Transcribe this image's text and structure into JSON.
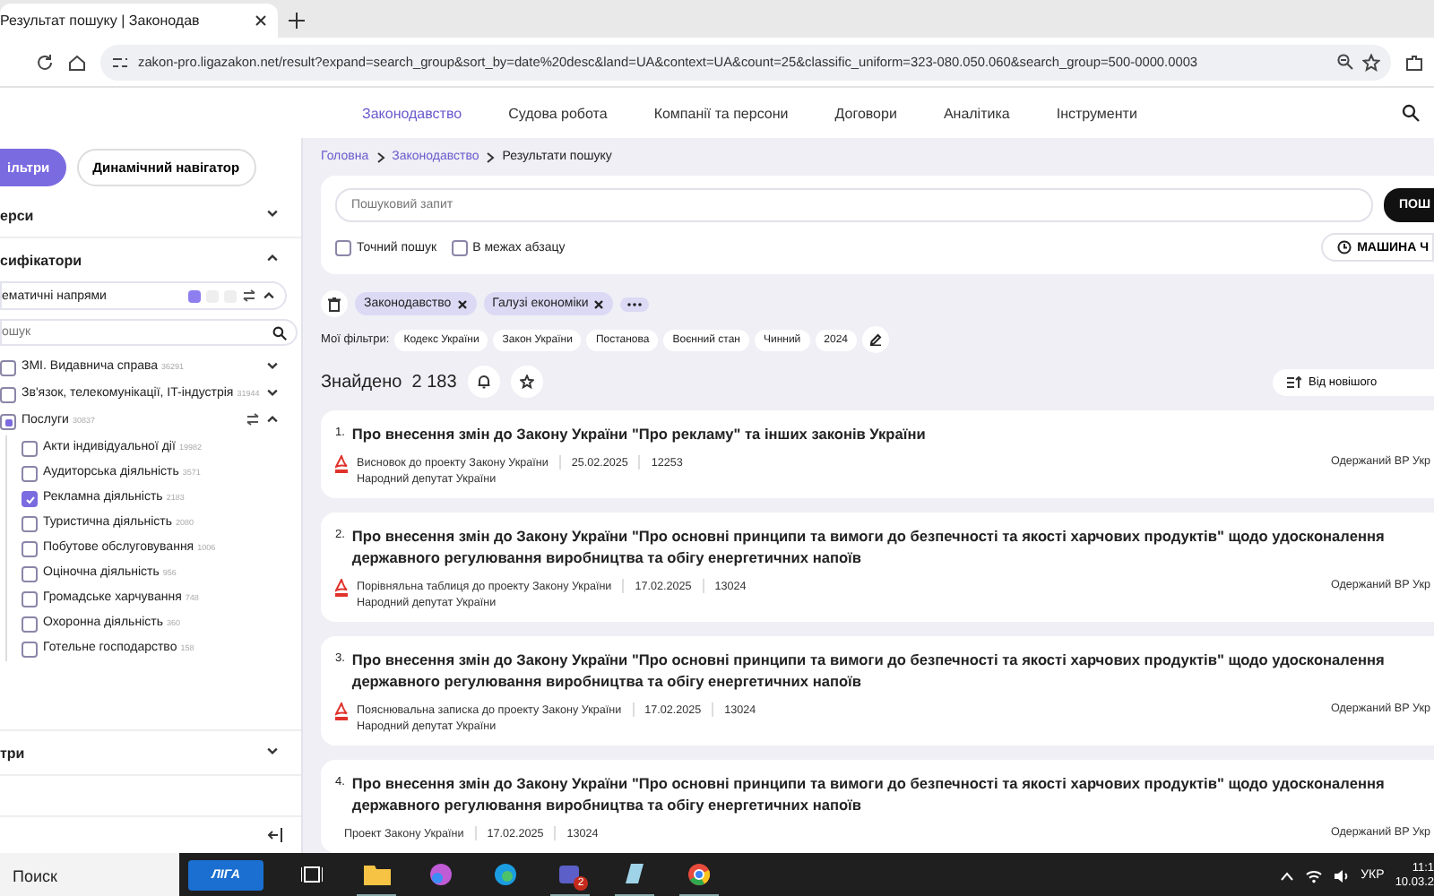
{
  "browser": {
    "tab_title": "Результат пошуку | Законодав",
    "address": "zakon-pro.ligazakon.net/result?expand=search_group&sort_by=date%20desc&land=UA&context=UA&count=25&classific_uniform=323-080.050.060&search_group=500-0000.0003"
  },
  "site_nav": [
    {
      "label": "Законодавство",
      "selected": true
    },
    {
      "label": "Судова робота",
      "selected": false
    },
    {
      "label": "Компанії та персони",
      "selected": false
    },
    {
      "label": "Договори",
      "selected": false
    },
    {
      "label": "Аналітика",
      "selected": false
    },
    {
      "label": "Інструменти",
      "selected": false
    }
  ],
  "sidebar": {
    "mode_tabs": [
      {
        "label": "ільтри",
        "selected": true
      },
      {
        "label": "Динамічний навігатор",
        "selected": false
      }
    ],
    "sections_top": [
      {
        "title": "ерси",
        "expanded": false
      },
      {
        "title": "сифікатори",
        "expanded": true
      }
    ],
    "classifier": {
      "title": "ематичні напрями",
      "toggles": [
        {
          "selected": true
        },
        {
          "selected": false
        },
        {
          "selected": false
        }
      ],
      "search_placeholder": "ошук",
      "tree": [
        {
          "label": "ЗМІ. Видавнича справа",
          "count": "36291",
          "partial": false,
          "expanded": false
        },
        {
          "label": "Зв'язок, телекомунікації, IT-індустрія",
          "count": "31944",
          "partial": false,
          "expanded": false
        },
        {
          "label": "Послуги",
          "count": "30837",
          "partial": true,
          "expanded": true,
          "children": [
            {
              "label": "Акти індивідуальної дії",
              "count": "19982",
              "checked": false
            },
            {
              "label": "Аудиторська діяльність",
              "count": "3571",
              "checked": false
            },
            {
              "label": "Рекламна діяльність",
              "count": "2183",
              "checked": true
            },
            {
              "label": "Туристична діяльність",
              "count": "2080",
              "checked": false
            },
            {
              "label": "Побутове обслуговування",
              "count": "1006",
              "checked": false
            },
            {
              "label": "Оціночна діяльність",
              "count": "956",
              "checked": false
            },
            {
              "label": "Громадське харчування",
              "count": "748",
              "checked": false
            },
            {
              "label": "Охоронна діяльність",
              "count": "360",
              "checked": false
            },
            {
              "label": "Готельне господарство",
              "count": "158",
              "checked": false
            }
          ]
        }
      ]
    },
    "sections_bottom": [
      {
        "title": "три",
        "expanded": false
      }
    ]
  },
  "breadcrumbs": [
    {
      "label": "Головна",
      "link": true
    },
    {
      "label": "Законодавство",
      "link": true
    },
    {
      "label": "Результати пошуку",
      "link": false
    }
  ],
  "search": {
    "placeholder": "Пошуковий запит",
    "button": "ПОШ",
    "options": [
      {
        "label": "Точний пошук",
        "checked": false
      },
      {
        "label": "В межах абзацу",
        "checked": false
      }
    ],
    "machine_button": "МАШИНА Ч"
  },
  "active_filters": [
    {
      "label": "Законодавство"
    },
    {
      "label": "Галузі економіки"
    }
  ],
  "my_filters": {
    "label": "Мої фільтри:",
    "chips": [
      "Кодекс України",
      "Закон України",
      "Постанова",
      "Воєнний стан",
      "Чинний",
      "2024"
    ]
  },
  "results_header": {
    "label": "Знайдено",
    "count": "2 183",
    "sort": "Від новішого"
  },
  "results": [
    {
      "number": "1.",
      "title": "Про внесення змін до Закону України \"Про рекламу\" та інших законів України",
      "pdf": true,
      "doc_type": "Висновок до проекту Закону України",
      "date": "25.02.2025",
      "code": "12253",
      "author": "Народний депутат України",
      "status": "Одержаний ВР Укр"
    },
    {
      "number": "2.",
      "title": "Про внесення змін до Закону України \"Про основні принципи та вимоги до безпечності та якості харчових продуктів\" щодо удосконалення державного регулювання виробництва та обігу енергетичних напоїв",
      "pdf": true,
      "doc_type": "Порівняльна таблиця до проекту Закону України",
      "date": "17.02.2025",
      "code": "13024",
      "author": "Народний депутат України",
      "status": "Одержаний ВР Укр"
    },
    {
      "number": "3.",
      "title": "Про внесення змін до Закону України \"Про основні принципи та вимоги до безпечності та якості харчових продуктів\" щодо удосконалення державного регулювання виробництва та обігу енергетичних напоїв",
      "pdf": true,
      "doc_type": "Пояснювальна записка до проекту Закону України",
      "date": "17.02.2025",
      "code": "13024",
      "author": "Народний депутат України",
      "status": "Одержаний ВР Укр"
    },
    {
      "number": "4.",
      "title": "Про внесення змін до Закону України \"Про основні принципи та вимоги до безпечності та якості харчових продуктів\" щодо удосконалення державного регулювання виробництва та обігу енергетичних напоїв",
      "pdf": false,
      "doc_type": "Проект Закону України",
      "date": "17.02.2025",
      "code": "13024",
      "status": "Одержаний ВР Укр"
    }
  ],
  "taskbar": {
    "search": "Поиск",
    "app_button": "ЛІГА",
    "apps": [
      {
        "kind": "taskview",
        "running": false
      },
      {
        "kind": "folder",
        "running": true
      },
      {
        "kind": "copilot",
        "running": false
      },
      {
        "kind": "edge",
        "running": false
      },
      {
        "kind": "teams",
        "running": true,
        "badge": "2"
      },
      {
        "kind": "notes",
        "running": true
      },
      {
        "kind": "chrome",
        "running": true
      }
    ],
    "language": "УКР",
    "time": "11:1",
    "date": "10.03.2"
  }
}
